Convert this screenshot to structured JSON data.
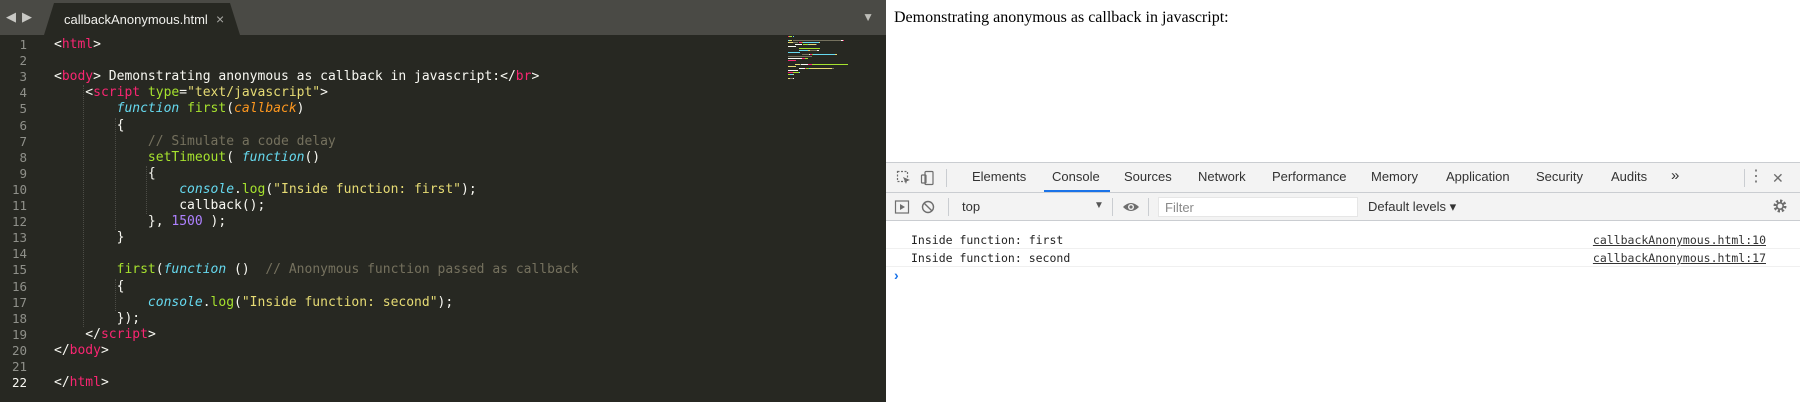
{
  "editor": {
    "nav_back": "◀",
    "nav_forward": "▶",
    "tab_title": "callbackAnonymous.html",
    "tab_close": "×",
    "tab_menu": "▼",
    "current_line": 22,
    "line_numbers": [
      "1",
      "2",
      "3",
      "4",
      "5",
      "6",
      "7",
      "8",
      "9",
      "10",
      "11",
      "12",
      "13",
      "14",
      "15",
      "16",
      "17",
      "18",
      "19",
      "20",
      "21",
      "22"
    ],
    "code_lines": [
      [
        [
          "t-plain",
          "<"
        ],
        [
          "t-tag",
          "html"
        ],
        [
          "t-plain",
          ">"
        ]
      ],
      [],
      [
        [
          "t-plain",
          "<"
        ],
        [
          "t-tag",
          "body"
        ],
        [
          "t-plain",
          "> Demonstrating anonymous as callback in javascript:</"
        ],
        [
          "t-tag",
          "br"
        ],
        [
          "t-plain",
          ">"
        ]
      ],
      [
        [
          "t-plain",
          "    <"
        ],
        [
          "t-tag",
          "script"
        ],
        [
          "t-plain",
          " "
        ],
        [
          "t-attr",
          "type"
        ],
        [
          "t-plain",
          "="
        ],
        [
          "t-str",
          "\"text/javascript\""
        ],
        [
          "t-plain",
          ">"
        ]
      ],
      [
        [
          "t-plain",
          "        "
        ],
        [
          "t-kw",
          "function"
        ],
        [
          "t-plain",
          " "
        ],
        [
          "t-fn",
          "first"
        ],
        [
          "t-plain",
          "("
        ],
        [
          "t-param",
          "callback"
        ],
        [
          "t-plain",
          ")"
        ]
      ],
      [
        [
          "t-plain",
          "        {"
        ]
      ],
      [
        [
          "t-plain",
          "            "
        ],
        [
          "t-com",
          "// Simulate a code delay"
        ]
      ],
      [
        [
          "t-plain",
          "            "
        ],
        [
          "t-fn",
          "setTimeout"
        ],
        [
          "t-plain",
          "( "
        ],
        [
          "t-kw",
          "function"
        ],
        [
          "t-plain",
          "()"
        ]
      ],
      [
        [
          "t-plain",
          "            {"
        ]
      ],
      [
        [
          "t-plain",
          "                "
        ],
        [
          "t-sup",
          "console"
        ],
        [
          "t-plain",
          "."
        ],
        [
          "t-fn",
          "log"
        ],
        [
          "t-plain",
          "("
        ],
        [
          "t-str",
          "\"Inside function: first\""
        ],
        [
          "t-plain",
          ");"
        ]
      ],
      [
        [
          "t-plain",
          "                callback();"
        ]
      ],
      [
        [
          "t-plain",
          "            }, "
        ],
        [
          "t-num",
          "1500"
        ],
        [
          "t-plain",
          " );"
        ]
      ],
      [
        [
          "t-plain",
          "        }"
        ]
      ],
      [],
      [
        [
          "t-plain",
          "        "
        ],
        [
          "t-fn",
          "first"
        ],
        [
          "t-plain",
          "("
        ],
        [
          "t-kw",
          "function"
        ],
        [
          "t-plain",
          " ()  "
        ],
        [
          "t-com",
          "// Anonymous function passed as callback"
        ]
      ],
      [
        [
          "t-plain",
          "        {"
        ]
      ],
      [
        [
          "t-plain",
          "            "
        ],
        [
          "t-sup",
          "console"
        ],
        [
          "t-plain",
          "."
        ],
        [
          "t-fn",
          "log"
        ],
        [
          "t-plain",
          "("
        ],
        [
          "t-str",
          "\"Inside function: second\""
        ],
        [
          "t-plain",
          ");"
        ]
      ],
      [
        [
          "t-plain",
          "        });"
        ]
      ],
      [
        [
          "t-plain",
          "    </"
        ],
        [
          "t-tag",
          "script"
        ],
        [
          "t-plain",
          ">"
        ]
      ],
      [
        [
          "t-plain",
          "</"
        ],
        [
          "t-tag",
          "body"
        ],
        [
          "t-plain",
          ">"
        ]
      ],
      [],
      [
        [
          "t-plain",
          "</"
        ],
        [
          "t-tag",
          "html"
        ],
        [
          "t-plain",
          ">"
        ]
      ]
    ],
    "colors": {
      "background": "#272822",
      "tag": "#f92672",
      "attribute": "#a6e22e",
      "string": "#e6db74",
      "keyword": "#66d9ef",
      "parameter": "#fd971f",
      "comment": "#75715e",
      "number": "#ae81ff"
    }
  },
  "browser": {
    "page_text": "Demonstrating anonymous as callback in javascript:"
  },
  "devtools": {
    "inspect_icon": "inspect-element-icon",
    "device_icon": "device-toolbar-icon",
    "tabs": [
      {
        "label": "Elements"
      },
      {
        "label": "Console"
      },
      {
        "label": "Sources"
      },
      {
        "label": "Network"
      },
      {
        "label": "Performance"
      },
      {
        "label": "Memory"
      },
      {
        "label": "Application"
      },
      {
        "label": "Security"
      },
      {
        "label": "Audits"
      }
    ],
    "active_tab": "Console",
    "more_tabs": "»",
    "kebab": "⋮",
    "close": "✕",
    "toolbar": {
      "context": "top",
      "context_arrow": "▼",
      "filter_placeholder": "Filter",
      "levels": "Default levels ▾"
    },
    "console_messages": [
      {
        "text": "Inside function: first",
        "source": "callbackAnonymous.html:10"
      },
      {
        "text": "Inside function: second",
        "source": "callbackAnonymous.html:17"
      }
    ],
    "prompt": "›",
    "accent_color": "#1a73e8"
  }
}
